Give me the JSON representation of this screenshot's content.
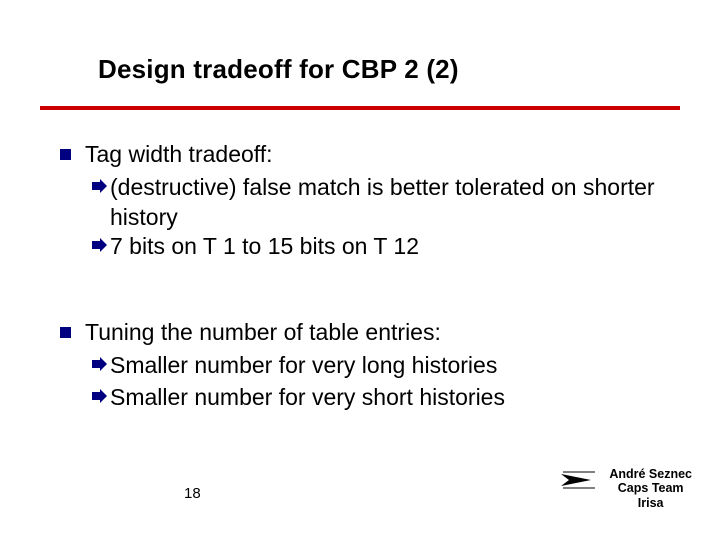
{
  "title": "Design tradeoff for CBP 2 (2)",
  "bullets": [
    {
      "text": "Tag width tradeoff:",
      "subs": [
        "(destructive) false match is better tolerated on shorter history",
        "7 bits on T 1 to 15 bits on T 12"
      ]
    },
    {
      "text": "Tuning the number of table entries:",
      "subs": [
        "Smaller number for very long histories",
        "Smaller number for very short histories"
      ]
    }
  ],
  "page_number": "18",
  "author": {
    "line1": "André Seznec",
    "line2": "Caps Team",
    "line3": "Irisa"
  },
  "colors": {
    "rule": "#cc0000",
    "bullet": "#000080",
    "arrow": "#000080"
  }
}
